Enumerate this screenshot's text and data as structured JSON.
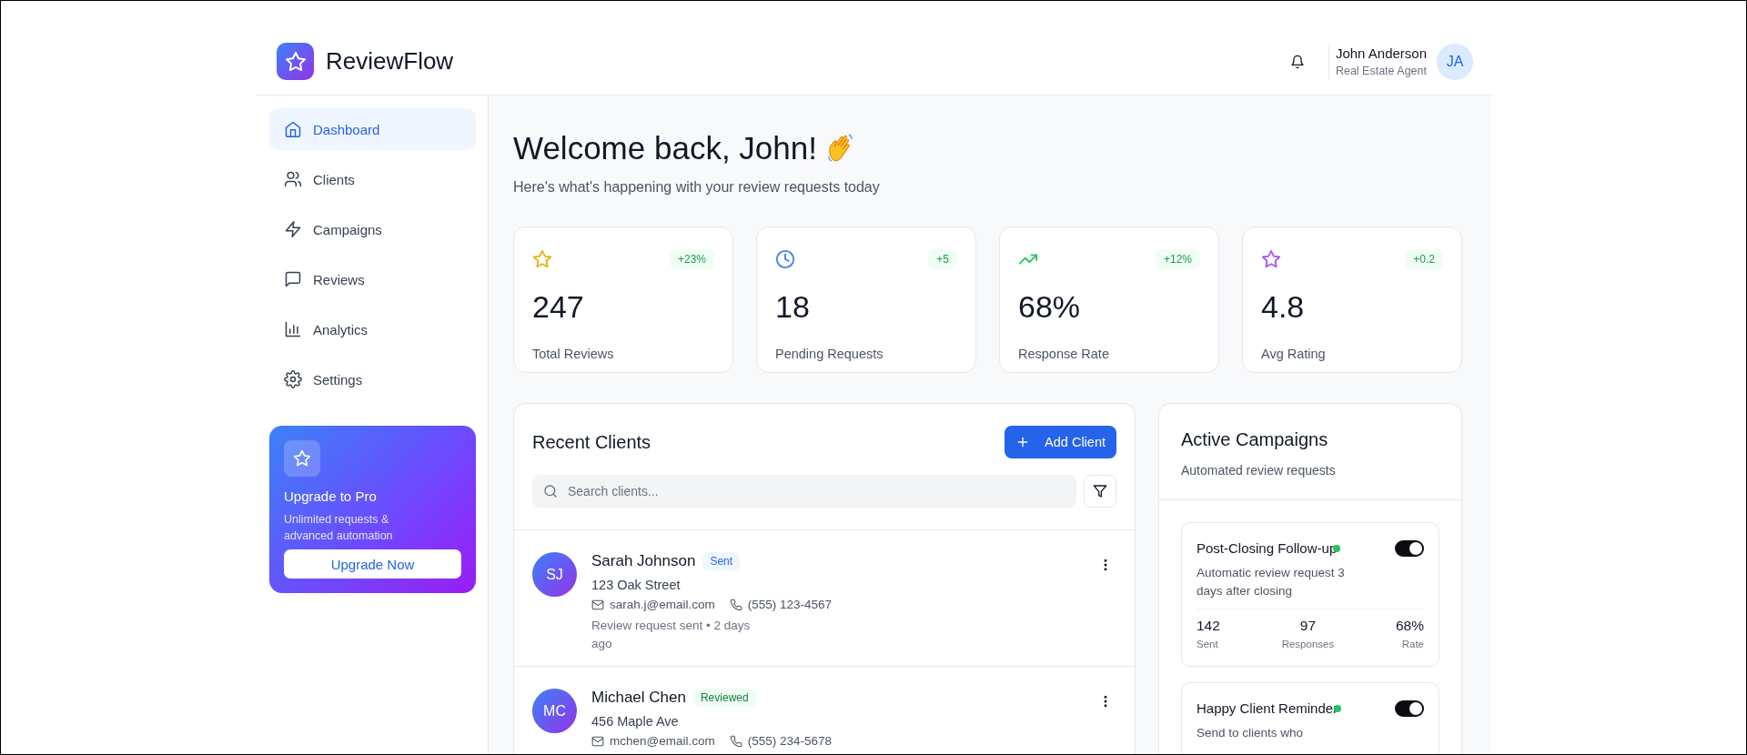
{
  "app": {
    "name": "ReviewFlow"
  },
  "header": {
    "user_name": "John Anderson",
    "user_role": "Real Estate Agent",
    "avatar_initials": "JA"
  },
  "sidebar": {
    "items": [
      {
        "label": "Dashboard",
        "selected": true
      },
      {
        "label": "Clients",
        "selected": false
      },
      {
        "label": "Campaigns",
        "selected": false
      },
      {
        "label": "Reviews",
        "selected": false
      },
      {
        "label": "Analytics",
        "selected": false
      },
      {
        "label": "Settings",
        "selected": false
      }
    ]
  },
  "upgrade": {
    "title": "Upgrade to Pro",
    "text": "Unlimited requests & advanced automation",
    "button": "Upgrade Now"
  },
  "welcome": {
    "title": "Welcome back, John!",
    "subtitle": "Here's what's happening with your review requests today"
  },
  "stats": [
    {
      "color": "#eab308",
      "change": "+23%",
      "value": "247",
      "label": "Total Reviews"
    },
    {
      "color": "#3b82f6",
      "change": "+5",
      "value": "18",
      "label": "Pending Requests"
    },
    {
      "color": "#22c55e",
      "change": "+12%",
      "value": "68%",
      "label": "Response Rate"
    },
    {
      "color": "#a855f7",
      "change": "+0.2",
      "value": "4.8",
      "label": "Avg Rating"
    }
  ],
  "clients": {
    "title": "Recent Clients",
    "add_button": "Add Client",
    "search": {
      "placeholder": "Search clients..."
    },
    "rows": [
      {
        "initials": "SJ",
        "name": "Sarah Johnson",
        "status": "Sent",
        "kind": "sent",
        "address": "123 Oak Street",
        "email": "sarah.j@email.com",
        "phone": "(555) 123-4567",
        "activity": "Review request sent • 2 days ago"
      },
      {
        "initials": "MC",
        "name": "Michael Chen",
        "status": "Reviewed",
        "kind": "reviewed",
        "address": "456 Maple Ave",
        "email": "mchen@email.com",
        "phone": "(555) 234-5678"
      }
    ]
  },
  "campaigns": {
    "title": "Active Campaigns",
    "subtitle": "Automated review requests",
    "items": [
      {
        "name": "Post-Closing Follow-up",
        "active": true,
        "on": true,
        "description": "Automatic review request 3 days after closing",
        "stats": [
          {
            "value": "142",
            "label": "Sent"
          },
          {
            "value": "97",
            "label": "Responses"
          },
          {
            "value": "68%",
            "label": "Rate"
          }
        ]
      },
      {
        "name": "Happy Client Reminder",
        "active": true,
        "on": true,
        "description": "Send to clients who"
      }
    ]
  }
}
